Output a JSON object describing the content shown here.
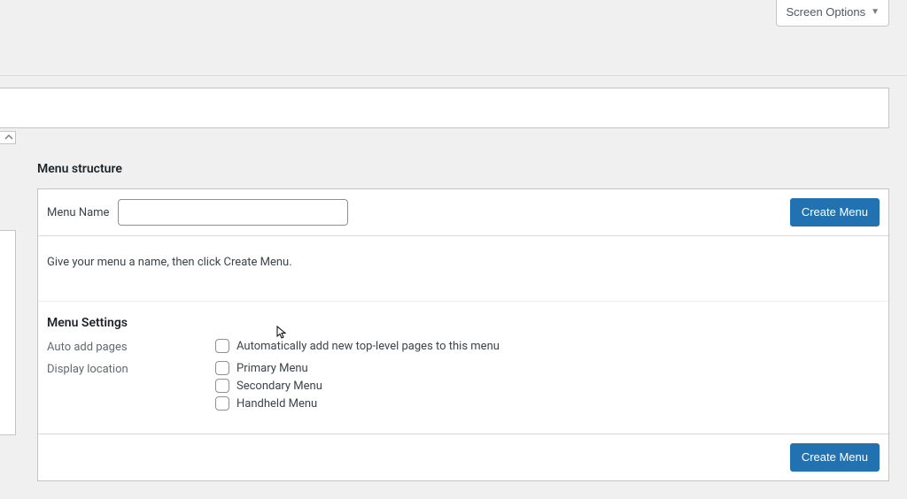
{
  "screen_options": {
    "label": "Screen Options"
  },
  "section": {
    "title": "Menu structure"
  },
  "menu_header": {
    "name_label": "Menu Name",
    "name_value": "",
    "create_btn": "Create Menu"
  },
  "help_text": "Give your menu a name, then click Create Menu.",
  "settings": {
    "title": "Menu Settings",
    "rows": {
      "auto_add": {
        "label": "Auto add pages",
        "option": "Automatically add new top-level pages to this menu"
      },
      "display_location": {
        "label": "Display location",
        "options": [
          "Primary Menu",
          "Secondary Menu",
          "Handheld Menu"
        ]
      }
    }
  },
  "footer": {
    "create_btn": "Create Menu"
  }
}
